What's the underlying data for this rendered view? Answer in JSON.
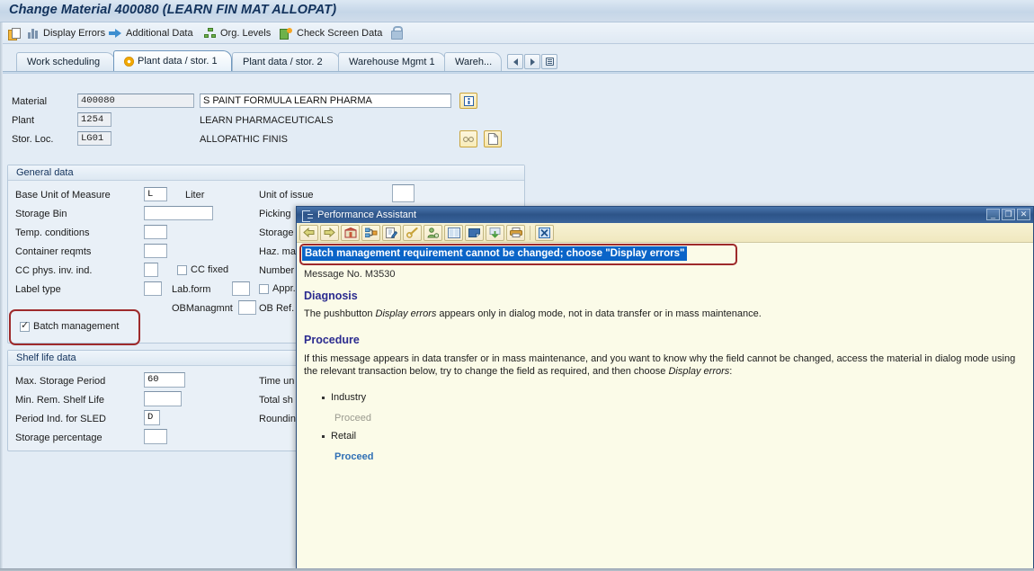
{
  "window": {
    "title": "Change Material 400080 (LEARN FIN MAT ALLOPAT)"
  },
  "toolbar": {
    "items": [
      {
        "label": "",
        "icon": "copy-icon"
      },
      {
        "label": "Display Errors",
        "icon": "bar-chart-icon"
      },
      {
        "label": "Additional Data",
        "icon": "arrow-right-icon"
      },
      {
        "label": "Org. Levels",
        "icon": "org-hierarchy-icon"
      },
      {
        "label": "Check Screen Data",
        "icon": "check-screen-icon"
      },
      {
        "label": "",
        "icon": "lock-icon"
      }
    ]
  },
  "tabs": {
    "items": [
      {
        "label": "Work scheduling",
        "active": false
      },
      {
        "label": "Plant data / stor. 1",
        "active": true
      },
      {
        "label": "Plant data / stor. 2",
        "active": false
      },
      {
        "label": "Warehouse Mgmt 1",
        "active": false
      },
      {
        "label": "Wareh...",
        "active": false
      }
    ],
    "nav": {
      "prev": "scroll-tabs-left",
      "next": "scroll-tabs-right",
      "list": "tab-list"
    }
  },
  "header": {
    "material": {
      "label": "Material",
      "value": "400080",
      "description": "S PAINT FORMULA LEARN PHARMA"
    },
    "plant": {
      "label": "Plant",
      "value": "1254",
      "description": "LEARN PHARMACEUTICALS"
    },
    "storage_location": {
      "label": "Stor. Loc.",
      "value": "LG01",
      "description": "ALLOPATHIC FINIS"
    },
    "buttons": {
      "info": "info-button",
      "glasses": "long-text-button",
      "doc": "create-doc-button"
    }
  },
  "general_data": {
    "title": "General data",
    "left_fields": [
      {
        "label": "Base Unit of Measure",
        "value": "L",
        "suffix": "Liter"
      },
      {
        "label": "Storage Bin",
        "value": "",
        "suffix": ""
      },
      {
        "label": "Temp. conditions",
        "value": "",
        "suffix": ""
      },
      {
        "label": "Container reqmts",
        "value": "",
        "suffix": ""
      },
      {
        "label": "CC phys. inv. ind.",
        "value": "",
        "suffix": ""
      },
      {
        "label": "Label type",
        "value": "",
        "suffix": ""
      }
    ],
    "mid_fields": [
      {
        "label": "CC fixed",
        "type": "checkbox",
        "checked": false
      },
      {
        "label": "Lab.form",
        "type": "field",
        "value": ""
      },
      {
        "label": "OBManagmnt",
        "type": "field",
        "value": ""
      }
    ],
    "right_labels": [
      "Unit of issue",
      "Picking",
      "Storage",
      "Haz. ma",
      "Number",
      "Appr.",
      "OB Ref."
    ],
    "batch_management": {
      "label": "Batch management",
      "checked": true
    }
  },
  "shelf_life": {
    "title": "Shelf life data",
    "fields": [
      {
        "label": "Max. Storage Period",
        "value": "60"
      },
      {
        "label": "Min. Rem. Shelf Life",
        "value": ""
      },
      {
        "label": "Period Ind. for SLED",
        "value": "D"
      },
      {
        "label": "Storage percentage",
        "value": ""
      }
    ],
    "right_labels": [
      "Time un",
      "Total sh",
      "Roundin"
    ]
  },
  "performance_assistant": {
    "title": "Performance Assistant",
    "window_controls": {
      "minimize": "_",
      "maximize": "❐",
      "close": "✕"
    },
    "toolbar_icons": [
      "back-icon",
      "forward-icon",
      "home-icon",
      "hierarchy-icon",
      "edit-icon",
      "technical-info-icon",
      "personal-note-icon",
      "glossary-icon",
      "note-icon",
      "save-icon",
      "print-icon",
      "close-icon"
    ],
    "message": "Batch management requirement cannot be changed; choose \"Display errors\"",
    "message_no_label": "Message No. M3530",
    "diagnosis": {
      "heading": "Diagnosis",
      "text_before": "The pushbutton ",
      "text_italic": "Display errors",
      "text_after": " appears only in dialog mode, not in data transfer or in mass maintenance."
    },
    "procedure": {
      "heading": "Procedure",
      "text_before": "If this message appears in data transfer or in mass maintenance, and you want to know why the field cannot be changed, access the material in dialog mode using the relevant transaction below, try to change the field as required, and then choose ",
      "text_italic": "Display errors",
      "text_after": ":",
      "items": [
        {
          "label": "Industry",
          "action": "Proceed",
          "enabled": false
        },
        {
          "label": "Retail",
          "action": "Proceed",
          "enabled": true
        }
      ]
    }
  },
  "colors": {
    "accent": "#0a64c8",
    "highlight_border": "#9e2a2b",
    "dialog_bg": "#fbfbe8",
    "heading": "#2b2b8f",
    "link": "#2f6fb5"
  }
}
